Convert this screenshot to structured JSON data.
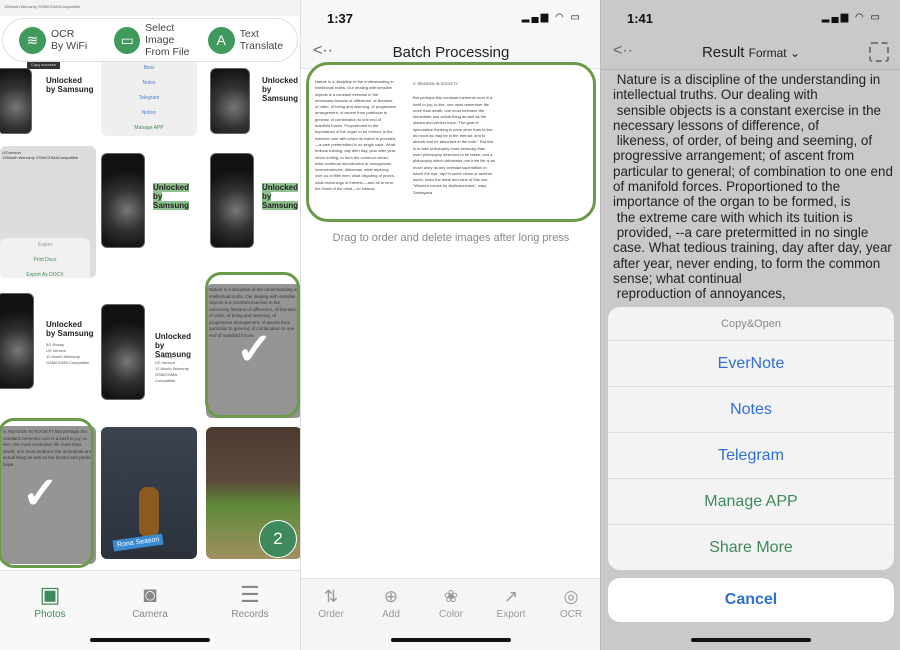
{
  "panel1": {
    "top_strip": "12Month Warranty GSM/CDMACompatible",
    "quick_actions": [
      {
        "icon": "wifi-icon",
        "line1": "OCR",
        "line2": "By WiFi"
      },
      {
        "icon": "folder-icon",
        "line1": "Select Image",
        "line2": "From File"
      },
      {
        "icon": "translate-icon",
        "line1": "Text",
        "line2": "Translate"
      }
    ],
    "copy_toast": "Copy success",
    "share_menu": [
      "Bear",
      "Notes",
      "Telegram",
      "Notion",
      "Manage APP"
    ],
    "export_menu": {
      "title": "Export",
      "items": [
        "Print Docx",
        "Export As DOCX"
      ]
    },
    "export_tile_text": [
      "USVersion",
      "12Month Warranty GSM/CDMACompatible"
    ],
    "samsung": {
      "title1": "Unlocked",
      "title2": "by Samsung",
      "bullets": [
        "5G Ready",
        "US Version",
        "12 Month Warranty",
        "GSM/CDMA Compatible"
      ]
    },
    "doc1_excerpt": "Nature is a discipline of the understanding in intellectual truths. Our dealing with sensible objects is a constant exercise in the necessary lessons of difference, of likeness, of order, of being and seeming, of progressive arrangement; of ascent from particular to general; of combination to one end of manifold forces.",
    "doc2_excerpt": "V. REASON IN SOCIETY  But perhaps this constant memento mori is a knell to joy; to live, one must remember life more than death; one must embrace the immediate and actual thing as well as the distant and perfect hope.",
    "video_caption": "Rona Season",
    "selected_count": "2",
    "tabs": [
      {
        "label": "Photos",
        "icon": "photos-icon",
        "active": true
      },
      {
        "label": "Camera",
        "icon": "camera-icon",
        "active": false
      },
      {
        "label": "Records",
        "icon": "records-icon",
        "active": false
      }
    ],
    "accent": "#3f9a5c"
  },
  "panel2": {
    "time": "1:37",
    "title": "Batch Processing",
    "page_left": "Nature is a discipline of the understanding in intellectual truths. Our dealing with sensible objects is a constant exercise in the necessary lessons of difference, of likeness, of order, of being and seeming, of progressive arrangement; of ascent from particular to general; of combination to one end of manifold forces. Proportioned to the importance of the organ to be formed, is the extreme care with which its tuition is provided,—a care pretermitted in no single case. What tedious training, day after day, year after year, never ending, to form the common sense; what continual reproduction of annoyances, inconveniences, dilemmas; what rejoicing over us of little men; what disputing of prices, what reckonings of interest,—and all to form the Hand of the mind;—to instruct",
    "page_right_heading": "V. REASON IN SOCIETY",
    "page_right": "But perhaps this constant memento mori is a knell to joy; to live, one must remember life more than death; one must embrace the immediate and actual thing as well as the distant and perfect hope.\"The goal of speculative thinking is none other than to live as much as may be in the eternal, and to absorb and be absorbed in the truth.\" But this is to take philosophy more seriously than even philosophy deserves to be taken; and a philosophy which withdraws one from life is as much awry as any celestial superstition in which the eye, rapt in some vision of another world, loses the meat and wine of this one. \"Wisdom comes by disillusionment,\" says Santayana",
    "hint": "Drag to order and delete images after long press",
    "toolbar": [
      {
        "label": "Order",
        "icon": "sort-icon"
      },
      {
        "label": "Add",
        "icon": "add-icon"
      },
      {
        "label": "Color",
        "icon": "color-icon"
      },
      {
        "label": "Export",
        "icon": "export-icon"
      },
      {
        "label": "OCR",
        "icon": "ocr-icon"
      }
    ]
  },
  "panel3": {
    "time": "1:41",
    "title": "Result",
    "format_label": "Format",
    "result_text": " Nature is a discipline of the understanding in intellectual truths. Our dealing with\n sensible objects is a constant exercise in the necessary lessons of difference, of\n likeness, of order, of being and seeming, of progressive arrangement; of ascent from particular to general; of combination to one end of manifold forces. Proportioned to the importance of the organ to be formed, is\n the extreme care with which its tuition is\n provided, --a care pretermitted in no single case. What tedious training, day after day, year after year, never ending, to form the common sense; what continual\n reproduction of annoyances,",
    "sheet_title": "Copy&Open",
    "sheet_items": [
      {
        "label": "EverNote",
        "color": "#2f6fd6"
      },
      {
        "label": "Notes",
        "color": "#2f6fd6"
      },
      {
        "label": "Telegram",
        "color": "#2f6fd6"
      },
      {
        "label": "Manage APP",
        "color": "#3f8a5c"
      },
      {
        "label": "Share More",
        "color": "#3f8a5c"
      }
    ],
    "cancel_label": "Cancel"
  }
}
